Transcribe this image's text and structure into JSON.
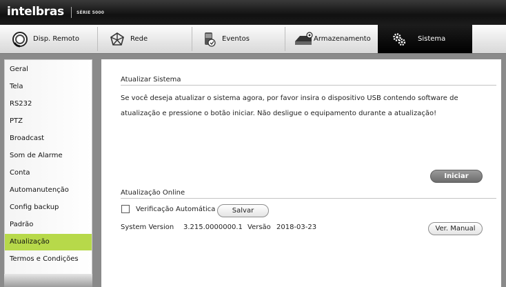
{
  "brand": {
    "logo": "intelbras",
    "series": "SÉRIE 5000"
  },
  "nav": {
    "tabs": [
      {
        "label": "Disp. Remoto",
        "icon": "remote-device-icon"
      },
      {
        "label": "Rede",
        "icon": "network-icon"
      },
      {
        "label": "Eventos",
        "icon": "events-icon"
      },
      {
        "label": "Armazenamento",
        "icon": "storage-icon"
      },
      {
        "label": "Sistema",
        "icon": "gears-icon"
      }
    ],
    "active": "Sistema"
  },
  "sidebar": {
    "items": [
      {
        "label": "Geral"
      },
      {
        "label": "Tela"
      },
      {
        "label": "RS232"
      },
      {
        "label": "PTZ"
      },
      {
        "label": "Broadcast"
      },
      {
        "label": "Som de Alarme"
      },
      {
        "label": "Conta"
      },
      {
        "label": "Automanutenção"
      },
      {
        "label": "Config backup"
      },
      {
        "label": "Padrão"
      },
      {
        "label": "Atualização"
      },
      {
        "label": "Termos e Condições"
      }
    ],
    "active": "Atualização",
    "active_color": "#b7d94a"
  },
  "update_system": {
    "title": "Atualizar Sistema",
    "description": "Se você deseja atualizar o sistema agora, por favor insira o dispositivo USB contendo software de atualização e pressione o botão iniciar. Não desligue o equipamento durante a atualização!",
    "start_button": "Iniciar"
  },
  "online_update": {
    "title": "Atualização Online",
    "auto_check_label": "Verificação Automática",
    "auto_check_checked": false,
    "save_button": "Salvar",
    "system_version_label": "System Version",
    "system_version_value": "3.215.0000000.1",
    "version_label": "Versão",
    "version_value": "2018-03-23",
    "manual_button": "Ver. Manual"
  }
}
